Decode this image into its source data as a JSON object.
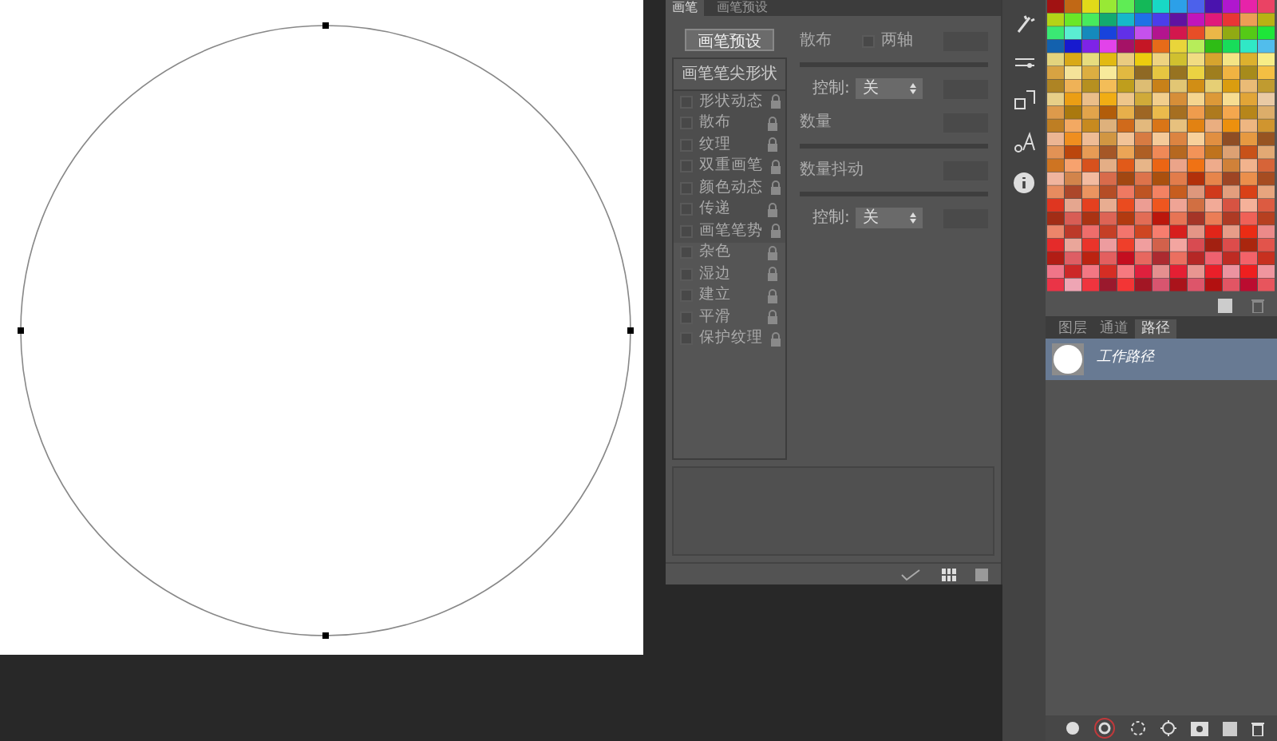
{
  "brush_panel": {
    "tabs": [
      {
        "label": "画笔",
        "selected": true
      },
      {
        "label": "画笔预设",
        "selected": false
      }
    ],
    "preset_button": "画笔预设",
    "tip_shape_header": "画笔笔尖形状",
    "options": [
      {
        "label": "形状动态",
        "checked": false
      },
      {
        "label": "散布",
        "checked": false
      },
      {
        "label": "纹理",
        "checked": false
      },
      {
        "label": "双重画笔",
        "checked": false
      },
      {
        "label": "颜色动态",
        "checked": false
      },
      {
        "label": "传递",
        "checked": false
      },
      {
        "label": "画笔笔势",
        "checked": false
      },
      {
        "label": "杂色",
        "checked": false
      },
      {
        "label": "湿边",
        "checked": false
      },
      {
        "label": "建立",
        "checked": false
      },
      {
        "label": "平滑",
        "checked": false
      },
      {
        "label": "保护纹理",
        "checked": false
      }
    ],
    "scatter_label": "散布",
    "both_axes": {
      "label": "两轴",
      "checked": false
    },
    "control_1": {
      "label": "控制:",
      "value": "关"
    },
    "count_label": "数量",
    "count_jitter_label": "数量抖动",
    "control_2": {
      "label": "控制:",
      "value": "关"
    }
  },
  "layers_panel": {
    "tabs": [
      {
        "label": "图层",
        "selected": false
      },
      {
        "label": "通道",
        "selected": false
      },
      {
        "label": "路径",
        "selected": true
      }
    ],
    "paths": [
      {
        "name": "工作路径",
        "selected": true
      }
    ]
  }
}
